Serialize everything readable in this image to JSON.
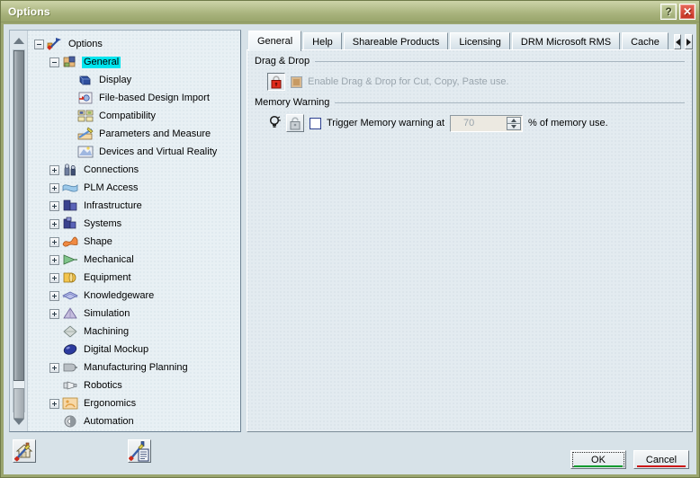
{
  "window": {
    "title": "Options",
    "help_button": "?",
    "close_button": "✕"
  },
  "tree": {
    "nodes": [
      {
        "label": "Options",
        "depth": 0,
        "expander": "minus",
        "icon": "options-icon",
        "selected": false
      },
      {
        "label": "General",
        "depth": 1,
        "expander": "minus",
        "icon": "general-icon",
        "selected": true
      },
      {
        "label": "Display",
        "depth": 2,
        "expander": "none",
        "icon": "display-icon",
        "selected": false
      },
      {
        "label": "File-based Design Import",
        "depth": 2,
        "expander": "none",
        "icon": "file-import-icon",
        "selected": false
      },
      {
        "label": "Compatibility",
        "depth": 2,
        "expander": "none",
        "icon": "compatibility-icon",
        "selected": false
      },
      {
        "label": "Parameters and Measure",
        "depth": 2,
        "expander": "none",
        "icon": "parameters-icon",
        "selected": false
      },
      {
        "label": "Devices and Virtual Reality",
        "depth": 2,
        "expander": "none",
        "icon": "devices-vr-icon",
        "selected": false
      },
      {
        "label": "Connections",
        "depth": 1,
        "expander": "plus",
        "icon": "connections-icon",
        "selected": false
      },
      {
        "label": "PLM Access",
        "depth": 1,
        "expander": "plus",
        "icon": "plm-access-icon",
        "selected": false
      },
      {
        "label": "Infrastructure",
        "depth": 1,
        "expander": "plus",
        "icon": "infrastructure-icon",
        "selected": false
      },
      {
        "label": "Systems",
        "depth": 1,
        "expander": "plus",
        "icon": "systems-icon",
        "selected": false
      },
      {
        "label": "Shape",
        "depth": 1,
        "expander": "plus",
        "icon": "shape-icon",
        "selected": false
      },
      {
        "label": "Mechanical",
        "depth": 1,
        "expander": "plus",
        "icon": "mechanical-icon",
        "selected": false
      },
      {
        "label": "Equipment",
        "depth": 1,
        "expander": "plus",
        "icon": "equipment-icon",
        "selected": false
      },
      {
        "label": "Knowledgeware",
        "depth": 1,
        "expander": "plus",
        "icon": "knowledgeware-icon",
        "selected": false
      },
      {
        "label": "Simulation",
        "depth": 1,
        "expander": "plus",
        "icon": "simulation-icon",
        "selected": false
      },
      {
        "label": "Machining",
        "depth": 1,
        "expander": "none",
        "icon": "machining-icon",
        "selected": false
      },
      {
        "label": "Digital Mockup",
        "depth": 1,
        "expander": "none",
        "icon": "digital-mockup-icon",
        "selected": false
      },
      {
        "label": "Manufacturing Planning",
        "depth": 1,
        "expander": "plus",
        "icon": "manufacturing-planning-icon",
        "selected": false
      },
      {
        "label": "Robotics",
        "depth": 1,
        "expander": "none",
        "icon": "robotics-icon",
        "selected": false
      },
      {
        "label": "Ergonomics",
        "depth": 1,
        "expander": "plus",
        "icon": "ergonomics-icon",
        "selected": false
      },
      {
        "label": "Automation",
        "depth": 1,
        "expander": "none",
        "icon": "automation-icon",
        "selected": false
      }
    ]
  },
  "tree_toolbar": {
    "home_button": "home-settings-icon",
    "doc_button": "document-settings-icon"
  },
  "tabs": {
    "items": [
      {
        "label": "General",
        "active": true
      },
      {
        "label": "Help",
        "active": false
      },
      {
        "label": "Shareable Products",
        "active": false
      },
      {
        "label": "Licensing",
        "active": false
      },
      {
        "label": "DRM Microsoft RMS",
        "active": false
      },
      {
        "label": "Cache",
        "active": false
      }
    ],
    "scroll_left": "scroll-left-icon",
    "scroll_right": "scroll-right-icon"
  },
  "page": {
    "drag_drop": {
      "group_title": "Drag & Drop",
      "lock_icon": "locked-padlock-icon",
      "checkbox_label": "Enable Drag & Drop for Cut, Copy, Paste use.",
      "checkbox_state": "checked-disabled"
    },
    "memory_warning": {
      "group_title": "Memory Warning",
      "bulb_icon": "lightbulb-icon",
      "lock_icon": "unlocked-padlock-icon",
      "checkbox_label": "Trigger Memory warning at",
      "checkbox_state": "unchecked",
      "spinner_value": "70",
      "suffix_label": "% of memory use."
    }
  },
  "footer": {
    "ok_label": "OK",
    "cancel_label": "Cancel"
  },
  "colors": {
    "titlebar": "#a8b37c",
    "selection": "#00e5ee",
    "ok_accent": "#0a9a2e",
    "cancel_accent": "#cc1717",
    "close_button": "#c53122"
  }
}
